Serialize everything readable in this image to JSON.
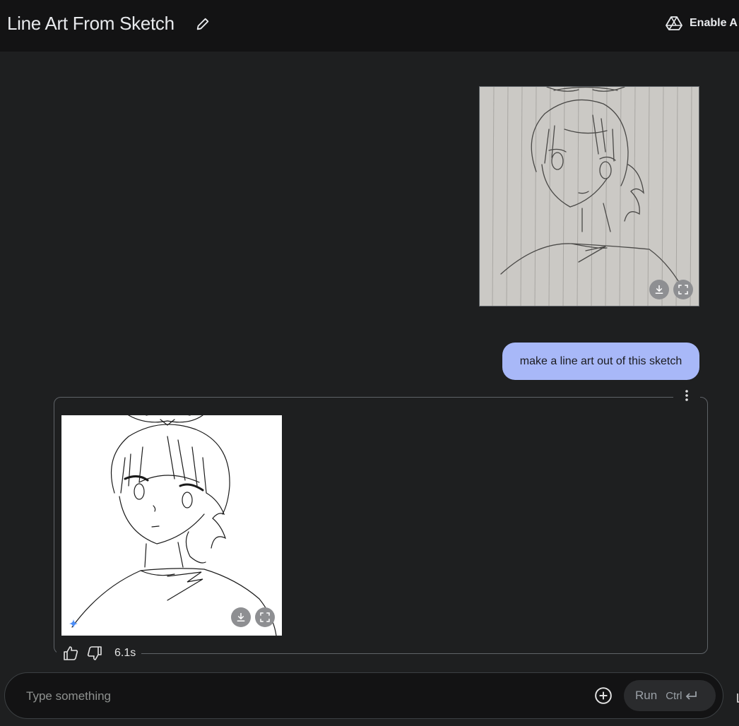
{
  "header": {
    "title": "Line Art From Sketch",
    "enable_label": "Enable A",
    "icons": {
      "edit": "pencil-icon",
      "drive": "google-drive-icon"
    }
  },
  "chat": {
    "user_image": {
      "icons": [
        "download-icon",
        "fullscreen-icon"
      ]
    },
    "user_message": "make a line art out of this sketch",
    "model_response": {
      "icons": [
        "more-vert-icon",
        "sparkle-icon",
        "download-icon",
        "fullscreen-icon"
      ],
      "feedback": {
        "icons": [
          "thumb-up-icon",
          "thumb-down-icon"
        ],
        "elapsed": "6.1s"
      }
    }
  },
  "composer": {
    "placeholder": "Type something",
    "run_label": "Run",
    "shortcut": "Ctrl",
    "icons": [
      "add-circle-icon",
      "enter-key-icon"
    ]
  },
  "colors": {
    "topbar": "#131314",
    "background": "#1e1f20",
    "user_bubble": "#a8b8f8",
    "accent_sparkle": "#4c8df6"
  }
}
